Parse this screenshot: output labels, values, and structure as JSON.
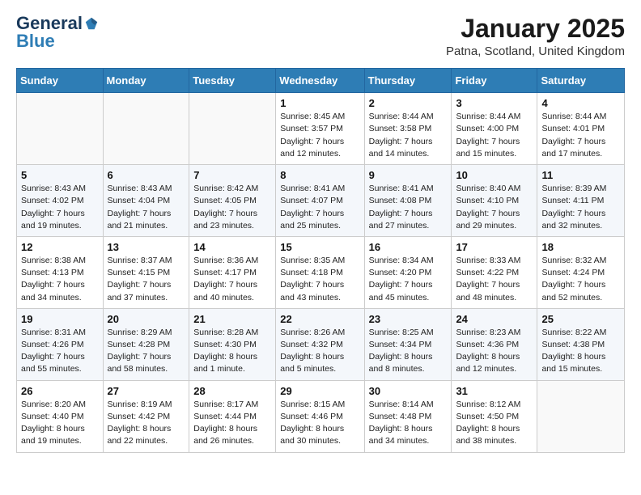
{
  "header": {
    "logo_general": "General",
    "logo_blue": "Blue",
    "month_title": "January 2025",
    "location": "Patna, Scotland, United Kingdom"
  },
  "days_of_week": [
    "Sunday",
    "Monday",
    "Tuesday",
    "Wednesday",
    "Thursday",
    "Friday",
    "Saturday"
  ],
  "weeks": [
    [
      {
        "day": "",
        "info": ""
      },
      {
        "day": "",
        "info": ""
      },
      {
        "day": "",
        "info": ""
      },
      {
        "day": "1",
        "info": "Sunrise: 8:45 AM\nSunset: 3:57 PM\nDaylight: 7 hours\nand 12 minutes."
      },
      {
        "day": "2",
        "info": "Sunrise: 8:44 AM\nSunset: 3:58 PM\nDaylight: 7 hours\nand 14 minutes."
      },
      {
        "day": "3",
        "info": "Sunrise: 8:44 AM\nSunset: 4:00 PM\nDaylight: 7 hours\nand 15 minutes."
      },
      {
        "day": "4",
        "info": "Sunrise: 8:44 AM\nSunset: 4:01 PM\nDaylight: 7 hours\nand 17 minutes."
      }
    ],
    [
      {
        "day": "5",
        "info": "Sunrise: 8:43 AM\nSunset: 4:02 PM\nDaylight: 7 hours\nand 19 minutes."
      },
      {
        "day": "6",
        "info": "Sunrise: 8:43 AM\nSunset: 4:04 PM\nDaylight: 7 hours\nand 21 minutes."
      },
      {
        "day": "7",
        "info": "Sunrise: 8:42 AM\nSunset: 4:05 PM\nDaylight: 7 hours\nand 23 minutes."
      },
      {
        "day": "8",
        "info": "Sunrise: 8:41 AM\nSunset: 4:07 PM\nDaylight: 7 hours\nand 25 minutes."
      },
      {
        "day": "9",
        "info": "Sunrise: 8:41 AM\nSunset: 4:08 PM\nDaylight: 7 hours\nand 27 minutes."
      },
      {
        "day": "10",
        "info": "Sunrise: 8:40 AM\nSunset: 4:10 PM\nDaylight: 7 hours\nand 29 minutes."
      },
      {
        "day": "11",
        "info": "Sunrise: 8:39 AM\nSunset: 4:11 PM\nDaylight: 7 hours\nand 32 minutes."
      }
    ],
    [
      {
        "day": "12",
        "info": "Sunrise: 8:38 AM\nSunset: 4:13 PM\nDaylight: 7 hours\nand 34 minutes."
      },
      {
        "day": "13",
        "info": "Sunrise: 8:37 AM\nSunset: 4:15 PM\nDaylight: 7 hours\nand 37 minutes."
      },
      {
        "day": "14",
        "info": "Sunrise: 8:36 AM\nSunset: 4:17 PM\nDaylight: 7 hours\nand 40 minutes."
      },
      {
        "day": "15",
        "info": "Sunrise: 8:35 AM\nSunset: 4:18 PM\nDaylight: 7 hours\nand 43 minutes."
      },
      {
        "day": "16",
        "info": "Sunrise: 8:34 AM\nSunset: 4:20 PM\nDaylight: 7 hours\nand 45 minutes."
      },
      {
        "day": "17",
        "info": "Sunrise: 8:33 AM\nSunset: 4:22 PM\nDaylight: 7 hours\nand 48 minutes."
      },
      {
        "day": "18",
        "info": "Sunrise: 8:32 AM\nSunset: 4:24 PM\nDaylight: 7 hours\nand 52 minutes."
      }
    ],
    [
      {
        "day": "19",
        "info": "Sunrise: 8:31 AM\nSunset: 4:26 PM\nDaylight: 7 hours\nand 55 minutes."
      },
      {
        "day": "20",
        "info": "Sunrise: 8:29 AM\nSunset: 4:28 PM\nDaylight: 7 hours\nand 58 minutes."
      },
      {
        "day": "21",
        "info": "Sunrise: 8:28 AM\nSunset: 4:30 PM\nDaylight: 8 hours\nand 1 minute."
      },
      {
        "day": "22",
        "info": "Sunrise: 8:26 AM\nSunset: 4:32 PM\nDaylight: 8 hours\nand 5 minutes."
      },
      {
        "day": "23",
        "info": "Sunrise: 8:25 AM\nSunset: 4:34 PM\nDaylight: 8 hours\nand 8 minutes."
      },
      {
        "day": "24",
        "info": "Sunrise: 8:23 AM\nSunset: 4:36 PM\nDaylight: 8 hours\nand 12 minutes."
      },
      {
        "day": "25",
        "info": "Sunrise: 8:22 AM\nSunset: 4:38 PM\nDaylight: 8 hours\nand 15 minutes."
      }
    ],
    [
      {
        "day": "26",
        "info": "Sunrise: 8:20 AM\nSunset: 4:40 PM\nDaylight: 8 hours\nand 19 minutes."
      },
      {
        "day": "27",
        "info": "Sunrise: 8:19 AM\nSunset: 4:42 PM\nDaylight: 8 hours\nand 22 minutes."
      },
      {
        "day": "28",
        "info": "Sunrise: 8:17 AM\nSunset: 4:44 PM\nDaylight: 8 hours\nand 26 minutes."
      },
      {
        "day": "29",
        "info": "Sunrise: 8:15 AM\nSunset: 4:46 PM\nDaylight: 8 hours\nand 30 minutes."
      },
      {
        "day": "30",
        "info": "Sunrise: 8:14 AM\nSunset: 4:48 PM\nDaylight: 8 hours\nand 34 minutes."
      },
      {
        "day": "31",
        "info": "Sunrise: 8:12 AM\nSunset: 4:50 PM\nDaylight: 8 hours\nand 38 minutes."
      },
      {
        "day": "",
        "info": ""
      }
    ]
  ]
}
